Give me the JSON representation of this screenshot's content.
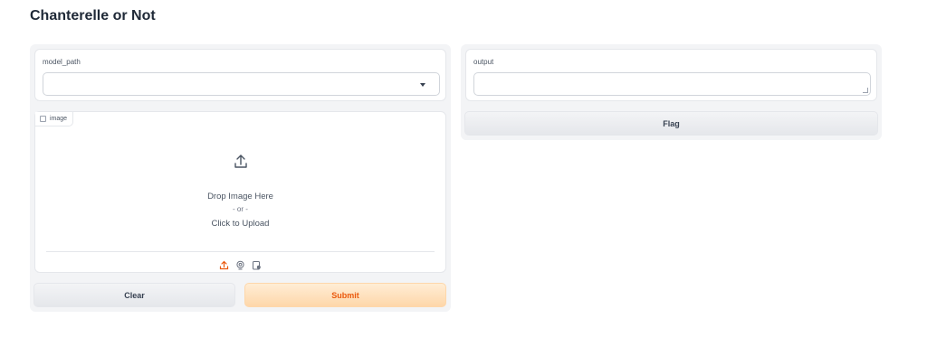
{
  "page": {
    "title": "Chanterelle or Not"
  },
  "inputs": {
    "model_path": {
      "label": "model_path",
      "value": ""
    },
    "image": {
      "label": "image",
      "drop_text": "Drop Image Here",
      "or_text": "- or -",
      "click_text": "Click to Upload",
      "sources": [
        "upload-icon",
        "webcam-icon",
        "clipboard-icon"
      ]
    }
  },
  "buttons": {
    "clear": "Clear",
    "submit": "Submit",
    "flag": "Flag"
  },
  "outputs": {
    "output": {
      "label": "output",
      "value": ""
    }
  },
  "colors": {
    "accent": "#ea580c",
    "accent_bg": "#fed7aa",
    "panel_bg": "#f3f4f6"
  }
}
